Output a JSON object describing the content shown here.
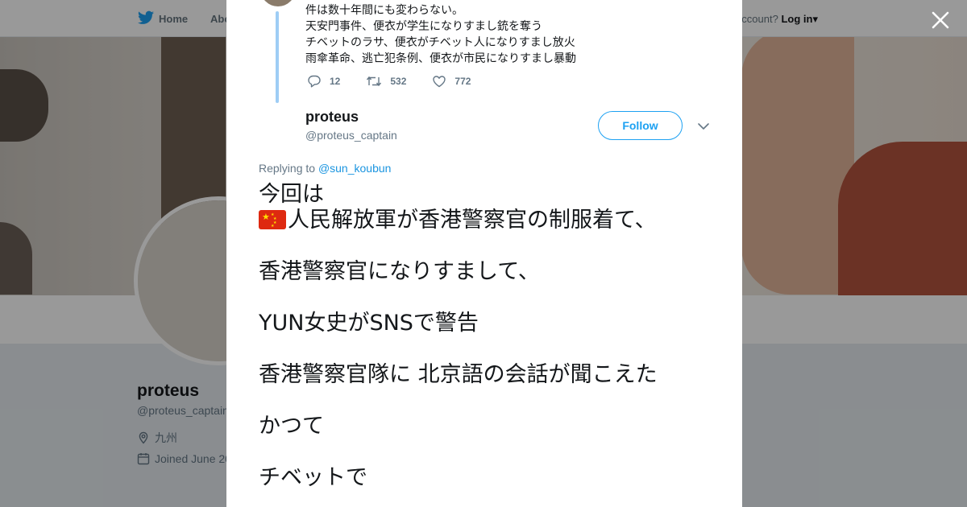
{
  "topnav": {
    "home_label": "Home",
    "about_label": "Abo",
    "account_prompt": "account?",
    "login_label": "Log in"
  },
  "profile": {
    "name": "proteus",
    "handle": "@proteus_captain",
    "location": "九州",
    "joined": "Joined June 20"
  },
  "parent_tweet": {
    "lines": [
      "件は数十年間にも変わらない。",
      "天安門事件、便衣が学生になりすまし銃を奪う",
      "チベットのラサ、便衣がチベット人になりすまし放火",
      "雨傘革命、逃亡犯条例、便衣が市民になりすまし暴動"
    ],
    "replies": "12",
    "retweets": "532",
    "likes": "772"
  },
  "tweet": {
    "author_name": "proteus",
    "author_handle": "@proteus_captain",
    "follow_label": "Follow",
    "replying_prefix": "Replying to",
    "replying_to": "@sun_koubun",
    "text": {
      "line1": "今回は",
      "line2": "人民解放軍が香港警察官の制服着て、",
      "line3": "香港警察官になりすまして、",
      "line4": "YUN女史がSNSで警告",
      "line5": "香港警察官隊に 北京語の会話が聞こえた",
      "line6": "かつて",
      "line7": "チベットで"
    }
  },
  "colors": {
    "brand": "#1da1f2",
    "thread_line": "#9ecdf5",
    "flag_red": "#de2910",
    "flag_star": "#ffde00"
  },
  "icons": [
    "twitter-bird-icon",
    "close-icon",
    "reply-icon",
    "retweet-icon",
    "like-icon",
    "chevron-down-icon",
    "location-icon",
    "calendar-icon",
    "china-flag-icon"
  ]
}
